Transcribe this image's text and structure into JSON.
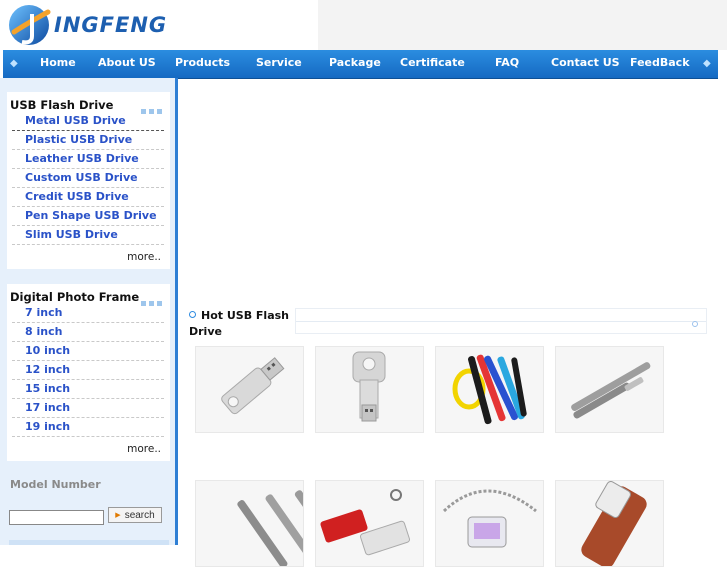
{
  "logo": {
    "text": "INGFENG"
  },
  "nav": {
    "items": [
      "Home",
      "About US",
      "Products",
      "Service",
      "Package",
      "Certificate",
      "FAQ",
      "Contact US",
      "FeedBack"
    ]
  },
  "usb_panel": {
    "title": "USB Flash Drive",
    "links": [
      "Metal USB Drive",
      "Plastic USB Drive",
      "Leather USB Drive",
      "Custom USB Drive",
      "Credit USB Drive",
      "Pen Shape USB Drive",
      "Slim USB Drive"
    ],
    "more": "more.."
  },
  "photo_panel": {
    "title": "Digital Photo Frame",
    "links": [
      "7 inch",
      "8 inch",
      "10 inch",
      "12 inch",
      "15 inch",
      "17 inch",
      "19 inch"
    ],
    "more": "more.."
  },
  "search": {
    "label": "Model Number",
    "value": "",
    "button": "search"
  },
  "hot": {
    "title": "Hot USB Flash Drive"
  },
  "products": [
    {
      "icon": "silver-key-usb-icon"
    },
    {
      "icon": "key-shape-usb-icon"
    },
    {
      "icon": "wristband-usb-icon"
    },
    {
      "icon": "pen-usb-icon"
    },
    {
      "icon": "pen-set-usb-icon"
    },
    {
      "icon": "swivel-usb-icon"
    },
    {
      "icon": "jewelry-chain-usb-icon"
    },
    {
      "icon": "leather-usb-icon"
    }
  ]
}
